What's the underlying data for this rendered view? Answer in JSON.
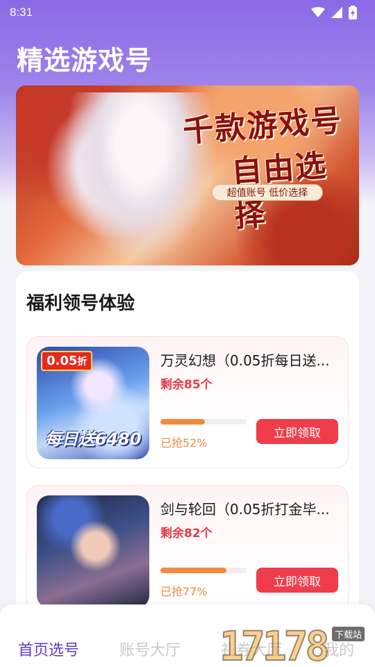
{
  "status_bar": {
    "time": "8:31",
    "icons": [
      "wifi-icon",
      "signal-icon",
      "battery-icon"
    ]
  },
  "header": {
    "title": "精选游戏号"
  },
  "banner": {
    "headline_1": "千款游戏号",
    "headline_2": "自由选择",
    "tagline": "超值账号 低价选择"
  },
  "section": {
    "title": "福利领号体验"
  },
  "items": [
    {
      "name": "万灵幻想（0.05折每日送...",
      "remaining": "剩余85个",
      "progress_label": "已抢52%",
      "progress": 0.52,
      "button": "立即领取",
      "thumb_badge": "0.05",
      "thumb_badge_suffix": "折",
      "thumb_caption": "每日送6480"
    },
    {
      "name": "剑与轮回（0.05折打金毕...",
      "remaining": "剩余82个",
      "progress_label": "已抢77%",
      "progress": 0.77,
      "button": "立即领取"
    }
  ],
  "tabbar": {
    "tabs": [
      "首页选号",
      "账号大厅",
      "礼券大厅",
      "我的"
    ],
    "active": 0
  },
  "watermark": {
    "text": "17178",
    "sub": "下载站"
  },
  "colors": {
    "accent": "#5a3cc8",
    "danger": "#ef3d4b",
    "progress": "#f08a3c"
  }
}
